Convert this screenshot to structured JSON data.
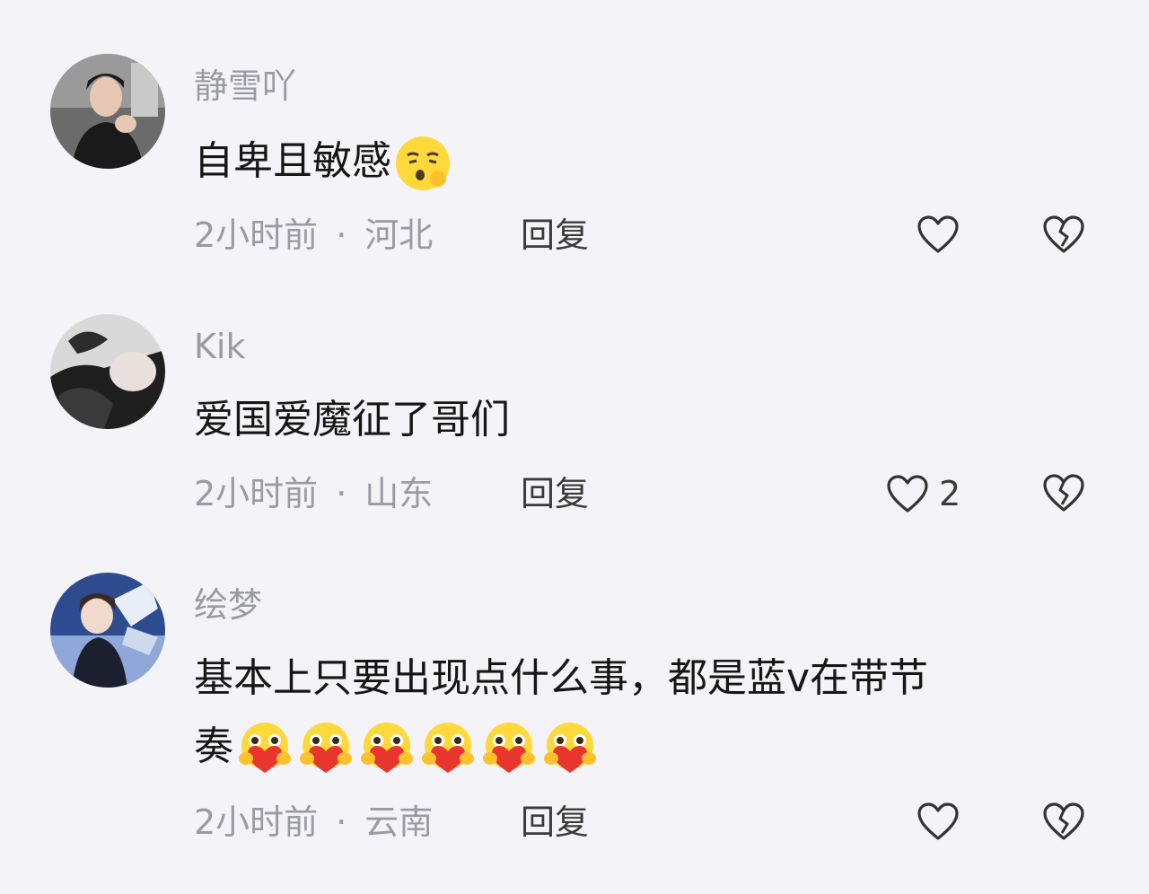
{
  "comments": [
    {
      "username": "静雪吖",
      "text": "自卑且敏感",
      "emoji": [
        "kiss-face-emoji"
      ],
      "time": "2小时前",
      "separator": "·",
      "location": "河北",
      "reply_label": "回复",
      "like_count": "",
      "like_icon": "heart-outline-icon",
      "dislike_icon": "broken-heart-icon"
    },
    {
      "username": "Kik",
      "text": "爱国爱魔征了哥们",
      "emoji": [],
      "time": "2小时前",
      "separator": "·",
      "location": "山东",
      "reply_label": "回复",
      "like_count": "2",
      "like_icon": "heart-outline-icon",
      "dislike_icon": "broken-heart-icon"
    },
    {
      "username": "绘梦",
      "text_line1": "基本上只要出现点什么事，都是蓝v在带节",
      "text_line2": "奏",
      "emoji": [
        "heart-hug-emoji",
        "heart-hug-emoji",
        "heart-hug-emoji",
        "heart-hug-emoji",
        "heart-hug-emoji",
        "heart-hug-emoji"
      ],
      "time": "2小时前",
      "separator": "·",
      "location": "云南",
      "reply_label": "回复",
      "like_count": "",
      "like_icon": "heart-outline-icon",
      "dislike_icon": "broken-heart-icon"
    }
  ]
}
